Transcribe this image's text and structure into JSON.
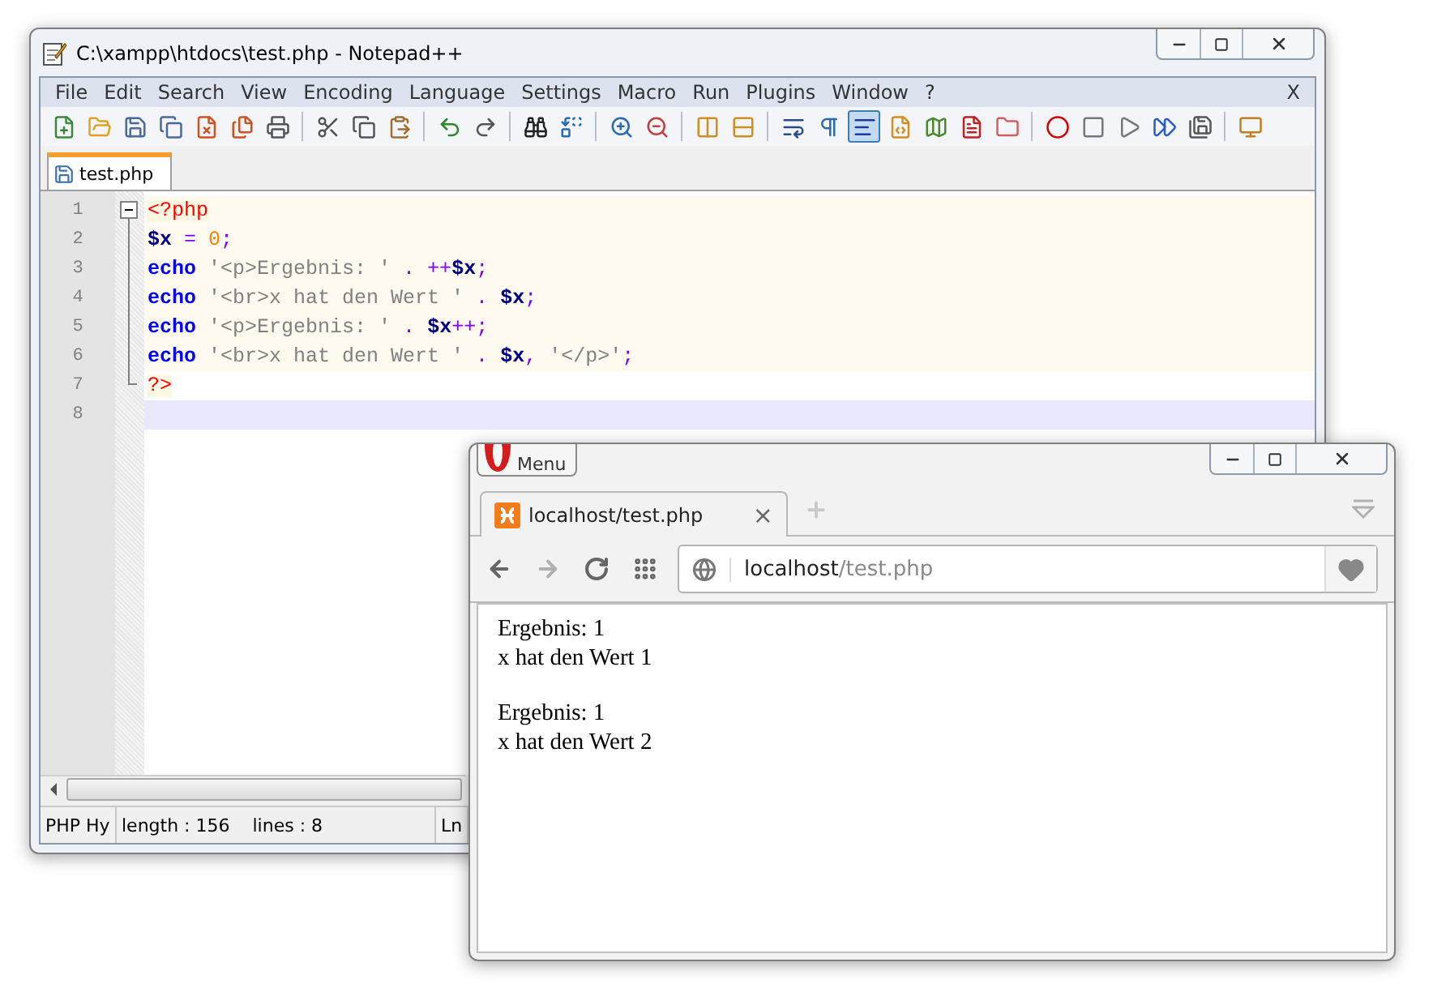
{
  "editor_window": {
    "title": "C:\\xampp\\htdocs\\test.php - Notepad++",
    "menu": [
      "File",
      "Edit",
      "Search",
      "View",
      "Encoding",
      "Language",
      "Settings",
      "Macro",
      "Run",
      "Plugins",
      "Window",
      "?"
    ],
    "menu_close": "X",
    "toolbar": [
      {
        "kind": "new",
        "active": false
      },
      {
        "kind": "open",
        "active": false
      },
      {
        "kind": "save",
        "active": false
      },
      {
        "kind": "save-all",
        "active": false
      },
      {
        "kind": "close",
        "active": false
      },
      {
        "kind": "close-all",
        "active": false
      },
      {
        "kind": "print",
        "active": false
      },
      {
        "kind": "separator"
      },
      {
        "kind": "cut",
        "active": false
      },
      {
        "kind": "copy",
        "active": false
      },
      {
        "kind": "paste",
        "active": false
      },
      {
        "kind": "separator"
      },
      {
        "kind": "undo",
        "active": false
      },
      {
        "kind": "redo",
        "active": false
      },
      {
        "kind": "separator"
      },
      {
        "kind": "find",
        "active": false
      },
      {
        "kind": "replace",
        "active": false
      },
      {
        "kind": "separator"
      },
      {
        "kind": "zoom-in",
        "active": false
      },
      {
        "kind": "zoom-out",
        "active": false
      },
      {
        "kind": "separator"
      },
      {
        "kind": "sync-v",
        "active": false
      },
      {
        "kind": "sync-h",
        "active": false
      },
      {
        "kind": "separator"
      },
      {
        "kind": "wrap",
        "active": false
      },
      {
        "kind": "all-chars",
        "active": false
      },
      {
        "kind": "indent-guide",
        "active": true
      },
      {
        "kind": "udl",
        "active": false
      },
      {
        "kind": "doc-map",
        "active": false
      },
      {
        "kind": "function-list",
        "active": false
      },
      {
        "kind": "folder",
        "active": false
      },
      {
        "kind": "separator"
      },
      {
        "kind": "record",
        "active": false
      },
      {
        "kind": "stop",
        "active": false
      },
      {
        "kind": "play",
        "active": false
      },
      {
        "kind": "play-multi",
        "active": false
      },
      {
        "kind": "save-macro",
        "active": false
      },
      {
        "kind": "separator"
      },
      {
        "kind": "launch",
        "active": false
      }
    ],
    "tabs": [
      {
        "label": "test.php",
        "selected": true
      }
    ],
    "lines": [
      {
        "number": "1",
        "embedded": true,
        "current": false,
        "tokens": [
          {
            "kind": "tag",
            "text": "<?php"
          }
        ]
      },
      {
        "number": "2",
        "embedded": true,
        "current": false,
        "tokens": [
          {
            "kind": "variable",
            "text": "$x"
          },
          {
            "kind": "operator",
            "text": " = "
          },
          {
            "kind": "number",
            "text": "0"
          },
          {
            "kind": "operator",
            "text": ";"
          }
        ]
      },
      {
        "number": "3",
        "embedded": true,
        "current": false,
        "tokens": [
          {
            "kind": "keyword",
            "text": "echo"
          },
          {
            "kind": "string",
            "text": " '<p>Ergebnis: '"
          },
          {
            "kind": "operator",
            "text": " . ++"
          },
          {
            "kind": "variable",
            "text": "$x"
          },
          {
            "kind": "operator",
            "text": ";"
          }
        ]
      },
      {
        "number": "4",
        "embedded": true,
        "current": false,
        "tokens": [
          {
            "kind": "keyword",
            "text": "echo"
          },
          {
            "kind": "string",
            "text": " '<br>x hat den Wert '"
          },
          {
            "kind": "operator",
            "text": " . "
          },
          {
            "kind": "variable",
            "text": "$x"
          },
          {
            "kind": "operator",
            "text": ";"
          }
        ]
      },
      {
        "number": "5",
        "embedded": true,
        "current": false,
        "tokens": [
          {
            "kind": "keyword",
            "text": "echo"
          },
          {
            "kind": "string",
            "text": " '<p>Ergebnis: '"
          },
          {
            "kind": "operator",
            "text": " . "
          },
          {
            "kind": "variable",
            "text": "$x"
          },
          {
            "kind": "operator",
            "text": "++;"
          }
        ]
      },
      {
        "number": "6",
        "embedded": true,
        "current": false,
        "tokens": [
          {
            "kind": "keyword",
            "text": "echo"
          },
          {
            "kind": "string",
            "text": " '<br>x hat den Wert '"
          },
          {
            "kind": "operator",
            "text": " . "
          },
          {
            "kind": "variable",
            "text": "$x"
          },
          {
            "kind": "operator",
            "text": ", "
          },
          {
            "kind": "string",
            "text": "'</p>'"
          },
          {
            "kind": "operator",
            "text": ";"
          }
        ]
      },
      {
        "number": "7",
        "embedded": false,
        "current": false,
        "tokens": [
          {
            "kind": "tag",
            "text": "?>"
          }
        ]
      },
      {
        "number": "8",
        "embedded": false,
        "current": true
      }
    ],
    "status": [
      "PHP Hy",
      "length : 156    lines : 8",
      "Ln"
    ]
  },
  "browser_window": {
    "menu_button": "Menu",
    "tabs": [
      {
        "label": "localhost/test.php",
        "selected": true,
        "close": "×"
      }
    ],
    "nav": [
      {
        "kind": "back",
        "disabled": false
      },
      {
        "kind": "forward",
        "disabled": true
      },
      {
        "kind": "reload",
        "disabled": false
      },
      {
        "kind": "speed-dial",
        "disabled": false
      }
    ],
    "address": {
      "host": "localhost",
      "path": "/test.php"
    },
    "content": [
      [
        "Ergebnis: 1",
        "x hat den Wert 1"
      ],
      [
        "Ergebnis: 1",
        "x hat den Wert 2"
      ]
    ]
  }
}
